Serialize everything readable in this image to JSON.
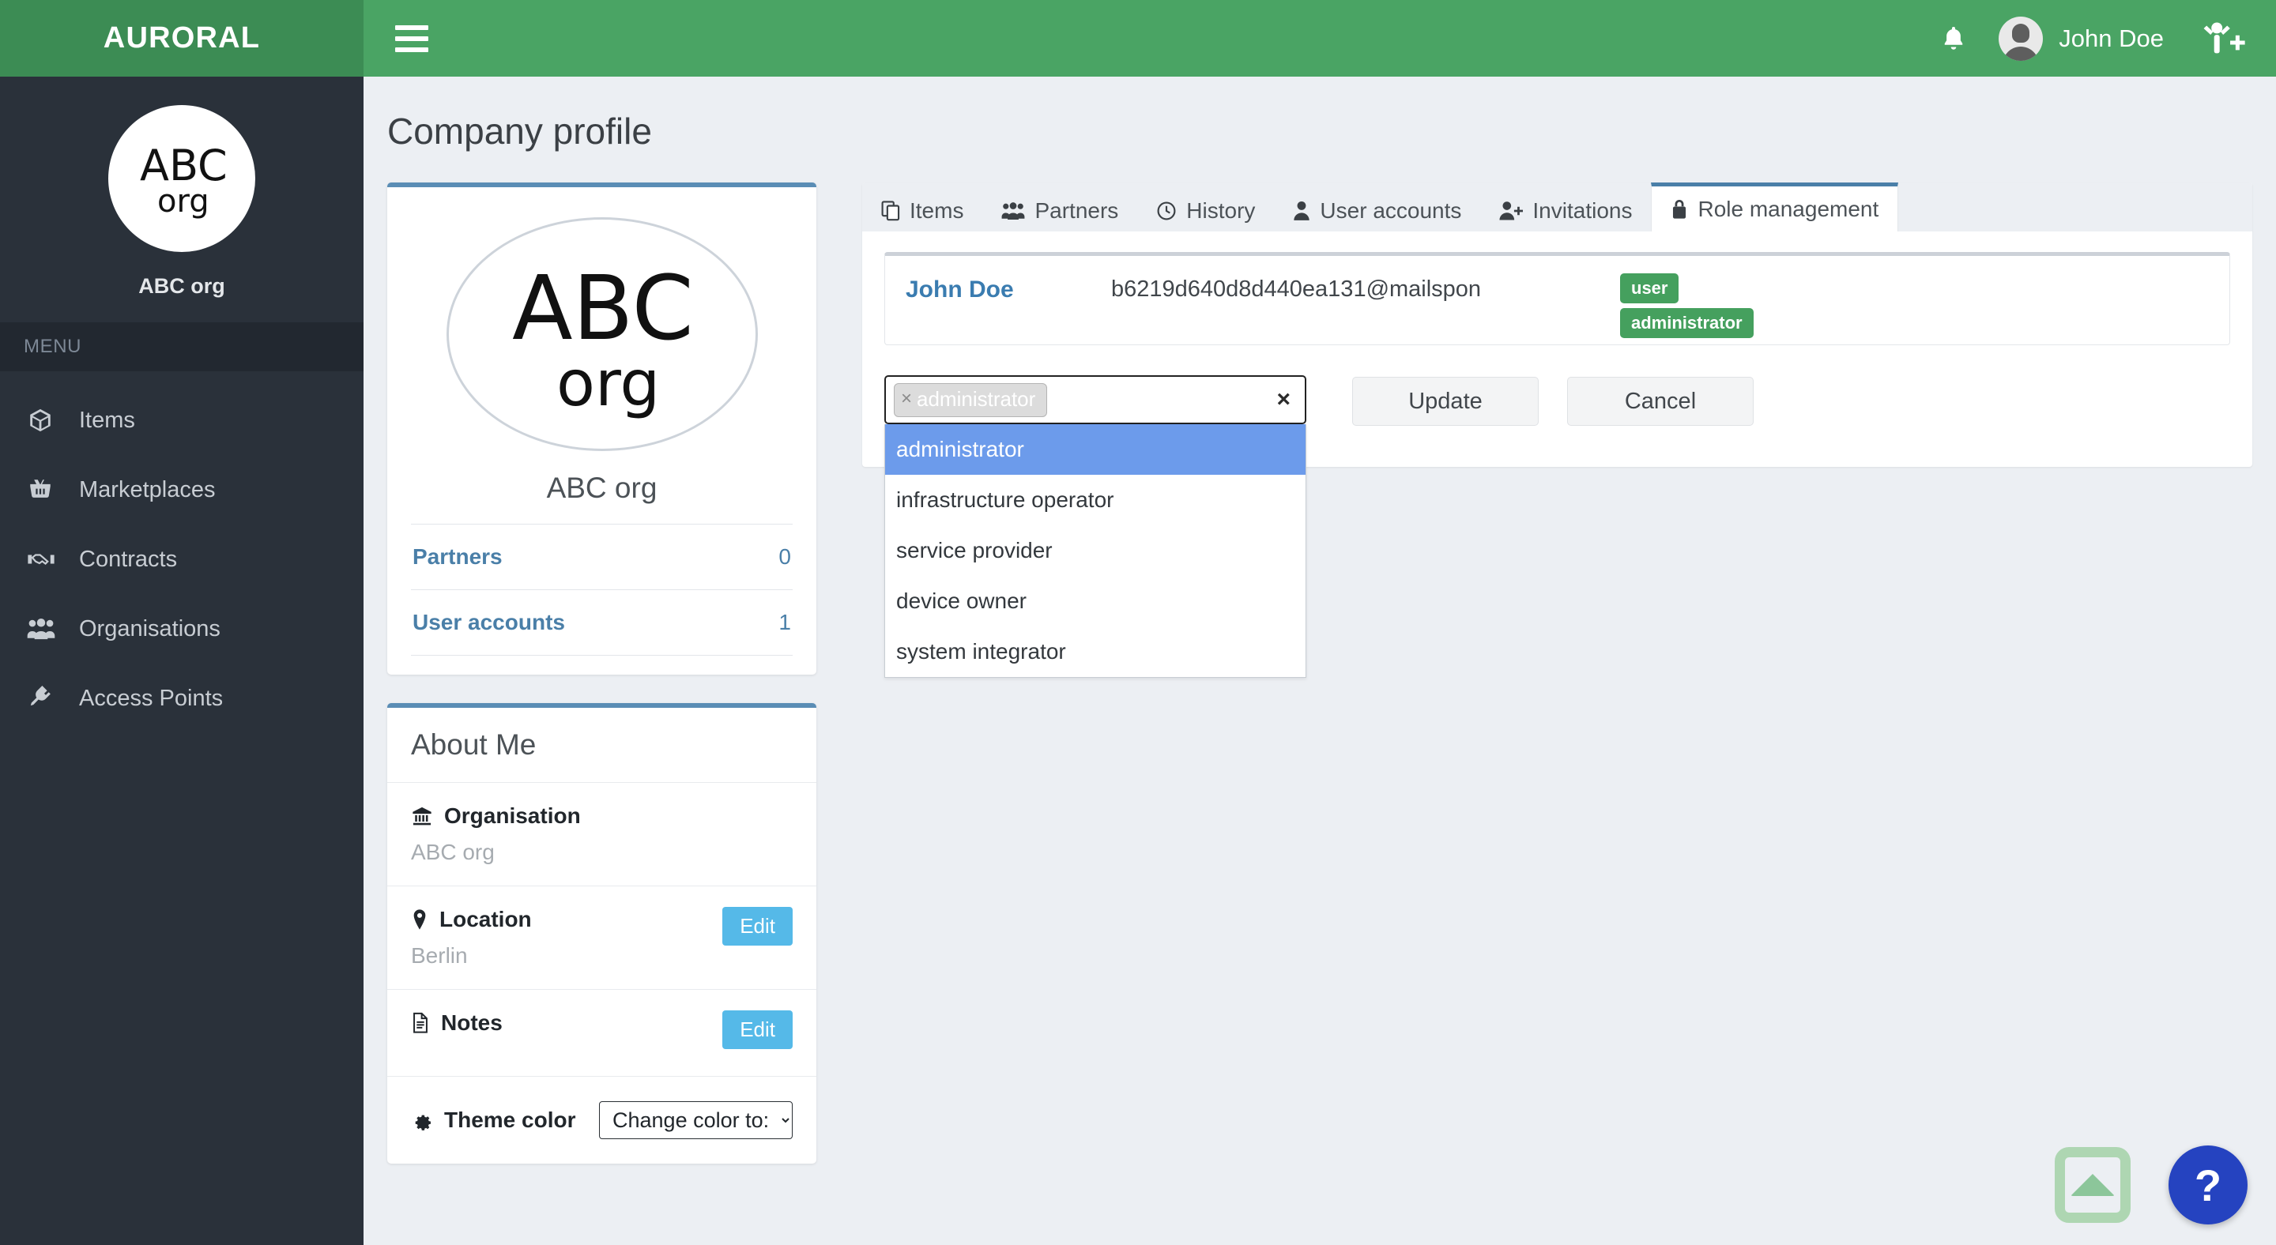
{
  "brand": {
    "name": "AURORAL"
  },
  "sidebar": {
    "org_name": "ABC org",
    "logo_text_top": "ABC",
    "logo_text_bottom": "org",
    "menu_label": "MENU",
    "items": [
      {
        "label": "Items",
        "icon": "box-icon"
      },
      {
        "label": "Marketplaces",
        "icon": "basket-icon"
      },
      {
        "label": "Contracts",
        "icon": "handshake-icon"
      },
      {
        "label": "Organisations",
        "icon": "users-icon"
      },
      {
        "label": "Access Points",
        "icon": "plug-icon"
      }
    ]
  },
  "topbar": {
    "menu_toggle": "hamburger-icon",
    "notification_icon": "bell-icon",
    "user_name": "John Doe",
    "add_user_icon": "person-add-icon"
  },
  "page": {
    "title": "Company profile"
  },
  "profile_card": {
    "logo_text_top": "ABC",
    "logo_text_bottom": "org",
    "name": "ABC org",
    "stats": [
      {
        "label": "Partners",
        "value": "0"
      },
      {
        "label": "User accounts",
        "value": "1"
      }
    ]
  },
  "about_card": {
    "title": "About Me",
    "rows": [
      {
        "icon": "bank-icon",
        "label": "Organisation",
        "value": "ABC org",
        "edit": null
      },
      {
        "icon": "location-pin-icon",
        "label": "Location",
        "value": "Berlin",
        "edit": "Edit"
      },
      {
        "icon": "document-icon",
        "label": "Notes",
        "value": "",
        "edit": "Edit"
      }
    ],
    "theme": {
      "icon": "gear-icon",
      "label": "Theme color",
      "select_value": "Change color to:"
    }
  },
  "tabs": [
    {
      "label": "Items",
      "icon": "clone-icon",
      "active": false
    },
    {
      "label": "Partners",
      "icon": "users-icon",
      "active": false
    },
    {
      "label": "History",
      "icon": "clock-icon",
      "active": false
    },
    {
      "label": "User accounts",
      "icon": "user-icon",
      "active": false
    },
    {
      "label": "Invitations",
      "icon": "user-plus-icon",
      "active": false
    },
    {
      "label": "Role management",
      "icon": "lock-icon",
      "active": true
    }
  ],
  "role_management": {
    "user": {
      "name": "John Doe",
      "email": "b6219d640d8d440ea131@mailspon",
      "badges": [
        "user",
        "administrator"
      ]
    },
    "role_select": {
      "chip_label": "administrator",
      "chip_remove": "×",
      "clear_all": "×",
      "options": [
        {
          "label": "administrator",
          "selected": true
        },
        {
          "label": "infrastructure operator",
          "selected": false
        },
        {
          "label": "service provider",
          "selected": false
        },
        {
          "label": "device owner",
          "selected": false
        },
        {
          "label": "system integrator",
          "selected": false
        }
      ]
    },
    "update_label": "Update",
    "cancel_label": "Cancel"
  },
  "floating": {
    "scroll_top_icon": "scroll-to-top-icon",
    "help_label": "?"
  },
  "colors": {
    "brand_green_dark": "#3c8c54",
    "topbar_green": "#4aa464",
    "sidebar_dark": "#2a313a",
    "accent_blue": "#4a7fa8",
    "badge_green": "#45a05e",
    "option_highlight": "#6c9beb",
    "edit_blue": "#55b9e8",
    "help_blue": "#2543c0",
    "page_bg": "#eceff3"
  }
}
